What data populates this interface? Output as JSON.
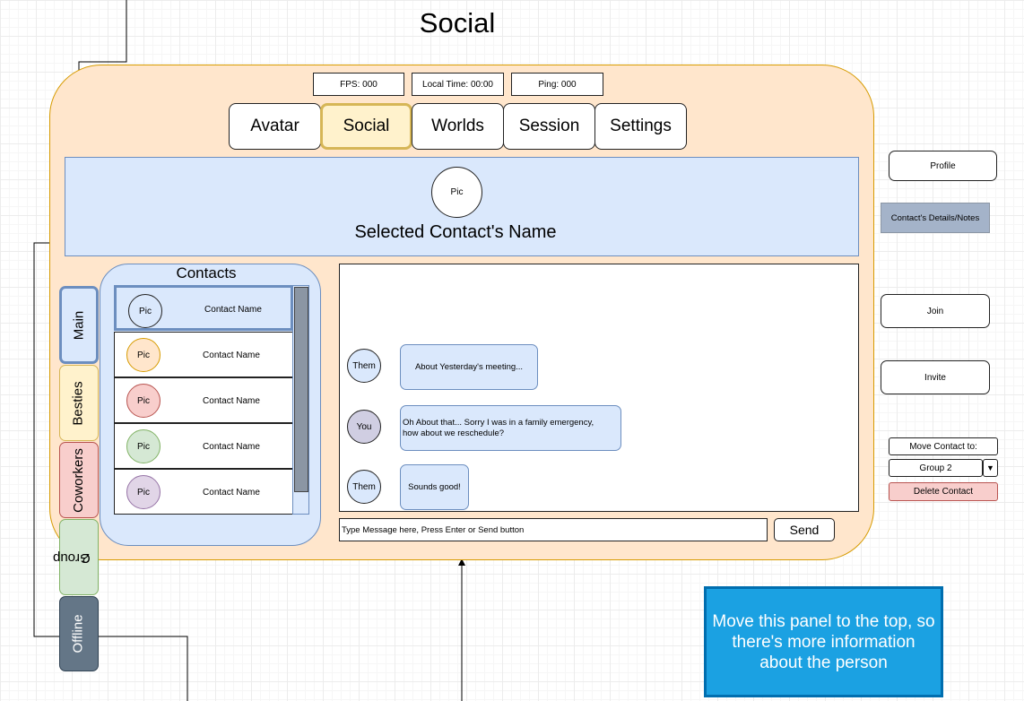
{
  "title": "Social",
  "stats": {
    "fps": "FPS: 000",
    "local_time": "Local Time: 00:00",
    "ping": "Ping: 000"
  },
  "nav_tabs": [
    "Avatar",
    "Social",
    "Worlds",
    "Session",
    "Settings"
  ],
  "active_tab": "Social",
  "selected_contact": {
    "pic": "Pic",
    "name": "Selected Contact's Name"
  },
  "contacts": {
    "title": "Contacts",
    "rows": [
      {
        "pic": "Pic",
        "name": "Contact Name",
        "color": "#dae8fc"
      },
      {
        "pic": "Pic",
        "name": "Contact Name",
        "color": "#ffe6cc"
      },
      {
        "pic": "Pic",
        "name": "Contact Name",
        "color": "#f8cecc"
      },
      {
        "pic": "Pic",
        "name": "Contact Name",
        "color": "#d5e8d4"
      },
      {
        "pic": "Pic",
        "name": "Contact Name",
        "color": "#e1d5e7"
      }
    ]
  },
  "group_tabs": [
    {
      "label": "Main",
      "color": "#dae8fc",
      "border": "#6c8ebf"
    },
    {
      "label": "Besties",
      "color": "#fff2cc",
      "border": "#d6b656"
    },
    {
      "label": "Coworkers",
      "color": "#f8cecc",
      "border": "#b85450"
    },
    {
      "label": "Group 2",
      "label_line1": "Group",
      "label_line2": "2",
      "color": "#d5e8d4",
      "border": "#82b366"
    },
    {
      "label": "Offline",
      "color": "#647687",
      "border": "#314354",
      "text_color": "#ffffff"
    }
  ],
  "chat": {
    "messages": [
      {
        "sender": "Them",
        "text": "About Yesterday's meeting...",
        "avatar_color": "#dae8fc"
      },
      {
        "sender": "You",
        "text_line1": "Oh About that... Sorry I was in a family emergency,",
        "text_line2": "how about we reschedule?",
        "avatar_color": "#d0cee2"
      },
      {
        "sender": "Them",
        "text": "Sounds good!",
        "avatar_color": "#dae8fc"
      }
    ],
    "input_placeholder": "Type Message here, Press Enter or Send button",
    "send_label": "Send"
  },
  "side_actions": {
    "profile": "Profile",
    "details_note": "Contact's Details/Notes",
    "join": "Join",
    "invite": "Invite",
    "move_contact": "Move Contact to:",
    "group_select": "Group 2",
    "delete": "Delete Contact"
  },
  "annotation": {
    "line1": "Move this panel to the top, so",
    "line2": "there's more information",
    "line3": "about the person"
  },
  "colors": {
    "panel": "#ffe6cc",
    "panel_border": "#d79b00",
    "header": "#dae8fc",
    "active_tab": "#fff2cc",
    "delete": "#f8cecc",
    "note": "#1ba1e2"
  }
}
